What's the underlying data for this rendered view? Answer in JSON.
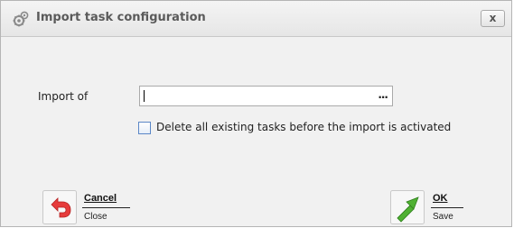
{
  "dialog": {
    "title": "Import task configuration",
    "close_label": "x"
  },
  "form": {
    "import_label": "Import of",
    "import_value": "",
    "browse_label": "...",
    "delete_checkbox_label": "Delete all existing tasks before the import is activated",
    "delete_checked": false
  },
  "buttons": {
    "cancel": {
      "label": "Cancel",
      "sub": "Close"
    },
    "ok": {
      "label": "OK",
      "sub": "Save"
    }
  },
  "colors": {
    "cancel_icon": "#e63b3b",
    "ok_icon": "#4fb132"
  }
}
